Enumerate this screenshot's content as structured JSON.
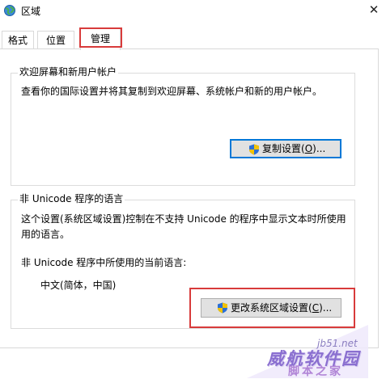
{
  "window": {
    "title": "区域",
    "close_glyph": "✕",
    "icon": "globe-icon"
  },
  "tabs": [
    {
      "label": "格式",
      "active": false
    },
    {
      "label": "位置",
      "active": false
    },
    {
      "label": "管理",
      "active": true
    }
  ],
  "welcome_group": {
    "legend": "欢迎屏幕和新用户帐户",
    "description": "查看你的国际设置并将其复制到欢迎屏幕、系统帐户和新的用户帐户。",
    "copy_button": {
      "text": "复制设置(",
      "mnemonic": "O",
      "suffix": ")..."
    }
  },
  "nonunicode_group": {
    "legend": "非 Unicode 程序的语言",
    "description_line1": "这个设置(系统区域设置)控制在不支持 Unicode 的程序中显示文本时所使用",
    "description_line2": "用的语言。",
    "current_label": "非 Unicode 程序中所使用的当前语言:",
    "current_value": "中文(简体，中国)",
    "change_button": {
      "text": "更改系统区域设置(",
      "mnemonic": "C",
      "suffix": ")..."
    }
  },
  "watermark": {
    "site": "jb51.net",
    "name": "脚本之家",
    "brand_line1": "威航软件园",
    "sub_text": "脚本之家"
  },
  "colors": {
    "highlight": "#d83b3b",
    "focus": "#0078d7",
    "button_bg": "#e1e1e1"
  }
}
